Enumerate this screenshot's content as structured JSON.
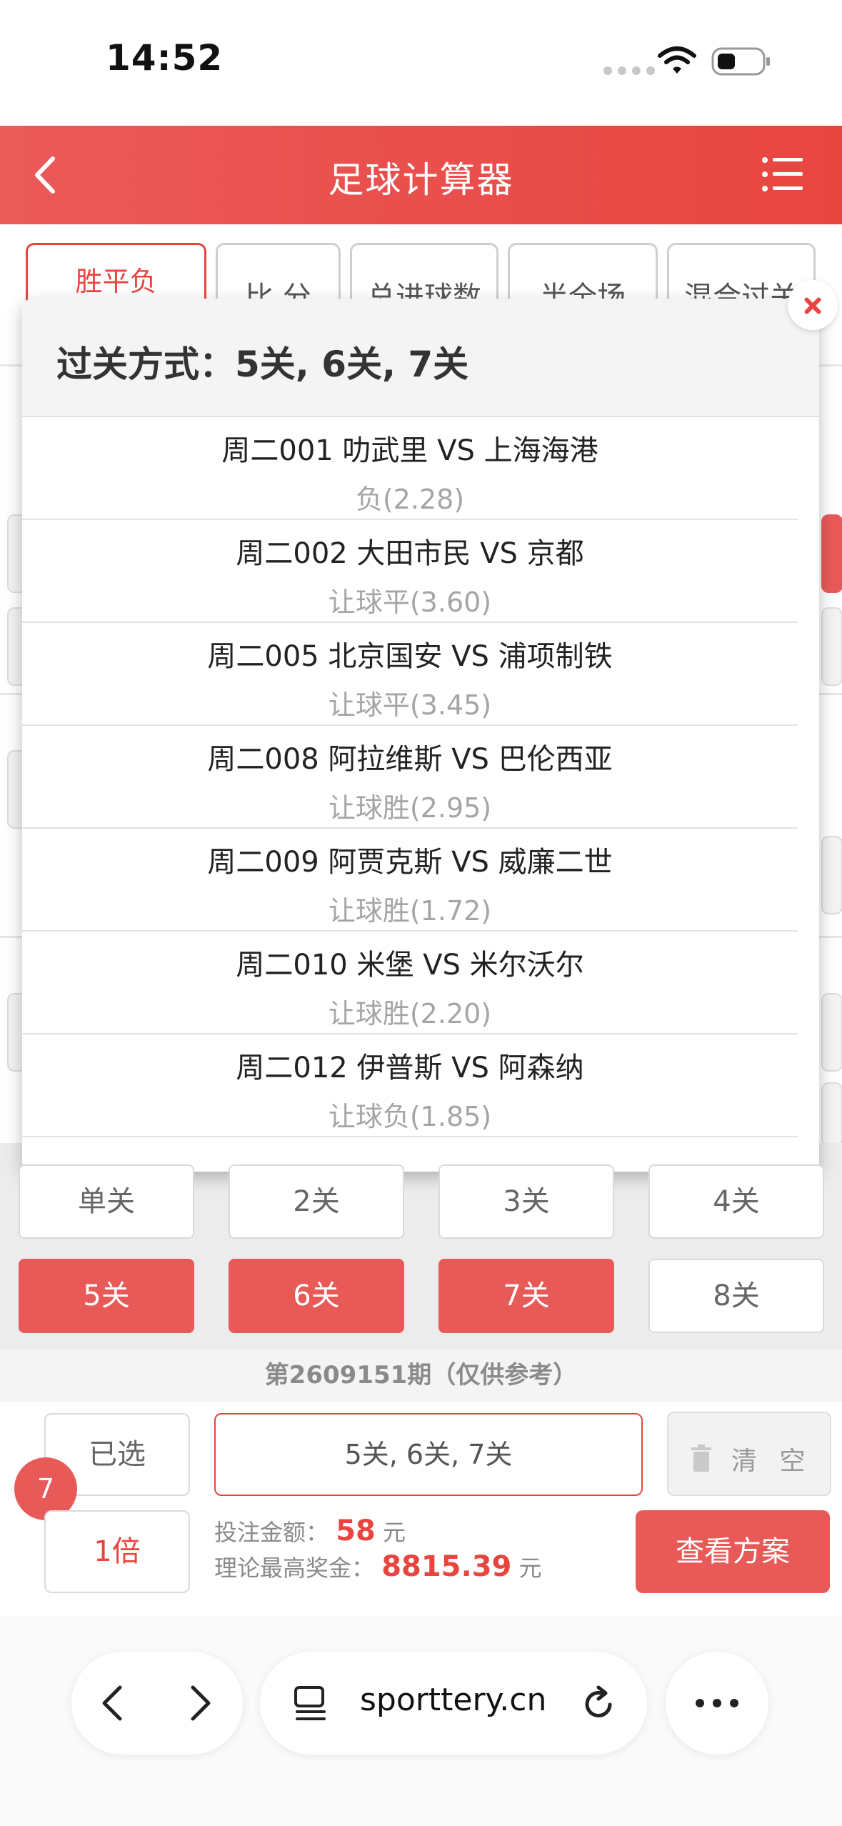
{
  "status": {
    "time": "14:52"
  },
  "header": {
    "title": "足球计算器",
    "back_icon": "chevron-left-icon",
    "menu_icon": "list-menu-icon"
  },
  "tabs": [
    {
      "label": "胜平负",
      "active": true
    },
    {
      "label": "比 分",
      "active": false
    },
    {
      "label": "总进球数",
      "active": false
    },
    {
      "label": "半全场",
      "active": false
    },
    {
      "label": "混合过关",
      "active": false
    }
  ],
  "modal": {
    "title": "过关方式：5关, 6关, 7关",
    "matches": [
      {
        "name": "周二001 叻武里 VS 上海海港",
        "odds": "负(2.28)"
      },
      {
        "name": "周二002 大田市民 VS 京都",
        "odds": "让球平(3.60)"
      },
      {
        "name": "周二005 北京国安 VS 浦项制铁",
        "odds": "让球平(3.45)"
      },
      {
        "name": "周二008 阿拉维斯 VS 巴伦西亚",
        "odds": "让球胜(2.95)"
      },
      {
        "name": "周二009 阿贾克斯 VS 威廉二世",
        "odds": "让球胜(1.72)"
      },
      {
        "name": "周二010 米堡 VS 米尔沃尔",
        "odds": "让球胜(2.20)"
      },
      {
        "name": "周二012 伊普斯 VS 阿森纳",
        "odds": "让球负(1.85)"
      }
    ]
  },
  "pass_options": [
    {
      "label": "单关",
      "selected": false
    },
    {
      "label": "2关",
      "selected": false
    },
    {
      "label": "3关",
      "selected": false
    },
    {
      "label": "4关",
      "selected": false
    },
    {
      "label": "5关",
      "selected": true
    },
    {
      "label": "6关",
      "selected": true
    },
    {
      "label": "7关",
      "selected": true
    },
    {
      "label": "8关",
      "selected": false
    }
  ],
  "period": "第2609151期（仅供参考）",
  "bottom": {
    "selected_count": "7",
    "selected_label": "已选",
    "pass_summary": "5关, 6关, 7关",
    "clear_label": "清 空",
    "multiplier": "1倍",
    "bet_amount_label": "投注金额：",
    "bet_amount": "58",
    "currency": "元",
    "max_prize_label": "理论最高奖金：",
    "max_prize": "8815.39",
    "view_plan": "查看方案"
  },
  "browser": {
    "url": "sporttery.cn"
  },
  "colors": {
    "accent": "#e8453f",
    "accent_light": "#e85a58"
  }
}
